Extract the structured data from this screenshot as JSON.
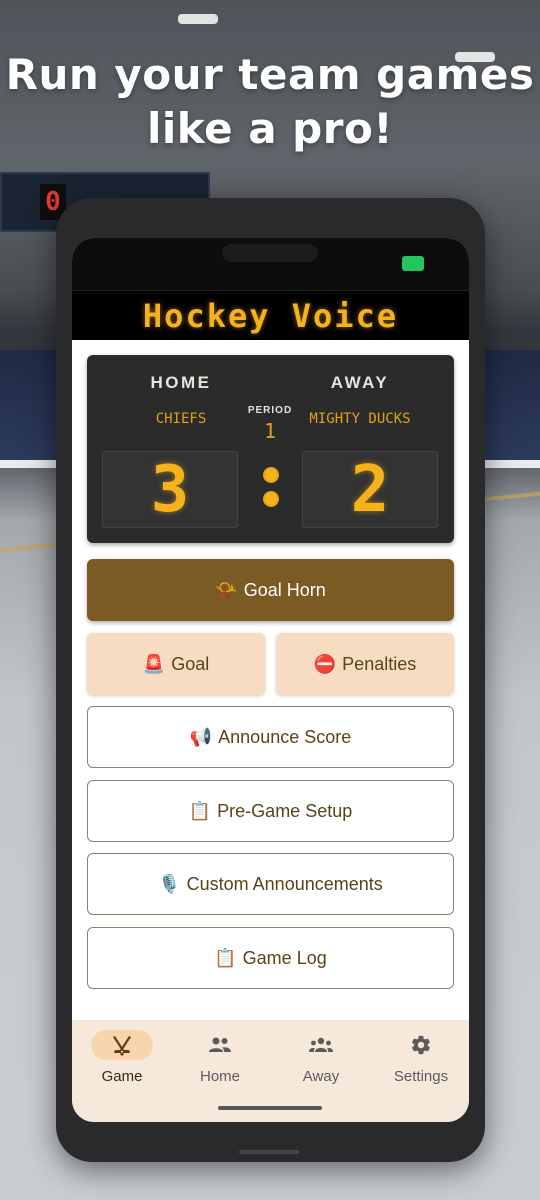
{
  "headline": {
    "line1": "Run your team games",
    "line2": "like a pro!"
  },
  "app": {
    "title": "Hockey Voice"
  },
  "scoreboard": {
    "home_label": "HOME",
    "away_label": "AWAY",
    "home_team": "CHIEFS",
    "away_team": "MIGHTY DUCKS",
    "period_label": "PERIOD",
    "period_value": "1",
    "home_score": "3",
    "away_score": "2",
    "led_color": "#f5b21a"
  },
  "actions": {
    "goal_horn": {
      "emoji": "📯",
      "label": "Goal Horn"
    },
    "goal": {
      "emoji": "🚨",
      "label": "Goal"
    },
    "penalties": {
      "emoji": "⛔",
      "label": "Penalties"
    },
    "announce_score": {
      "emoji": "📢",
      "label": "Announce Score"
    },
    "pre_game_setup": {
      "emoji": "📋",
      "label": "Pre-Game Setup"
    },
    "custom_announcements": {
      "emoji": "🎙️",
      "label": "Custom Announcements"
    },
    "game_log": {
      "emoji": "📋",
      "label": "Game Log"
    }
  },
  "bottom_nav": {
    "items": [
      {
        "label": "Game",
        "icon": "hockey-sticks-icon",
        "active": true
      },
      {
        "label": "Home",
        "icon": "people-icon",
        "active": false
      },
      {
        "label": "Away",
        "icon": "group-icon",
        "active": false
      },
      {
        "label": "Settings",
        "icon": "gear-icon",
        "active": false
      }
    ]
  },
  "colors": {
    "primary": "#7c5a24",
    "soft": "#f7dcc1",
    "nav_bg": "#f6e9dc",
    "nav_active_pill": "#f8d5ac"
  }
}
